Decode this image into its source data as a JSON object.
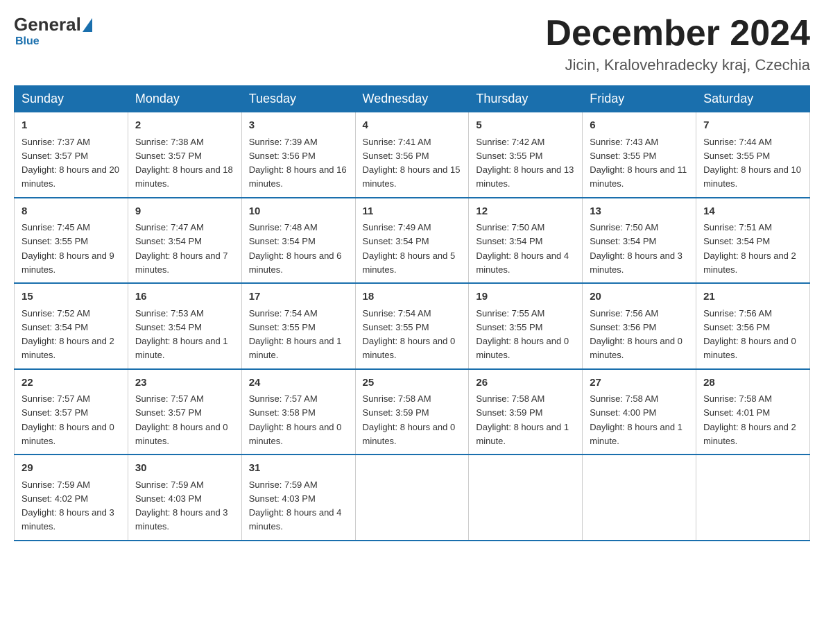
{
  "logo": {
    "general": "General",
    "blue": "Blue"
  },
  "title": "December 2024",
  "location": "Jicin, Kralovehradecky kraj, Czechia",
  "days_of_week": [
    "Sunday",
    "Monday",
    "Tuesday",
    "Wednesday",
    "Thursday",
    "Friday",
    "Saturday"
  ],
  "weeks": [
    [
      {
        "day": "1",
        "sunrise": "7:37 AM",
        "sunset": "3:57 PM",
        "daylight": "8 hours and 20 minutes."
      },
      {
        "day": "2",
        "sunrise": "7:38 AM",
        "sunset": "3:57 PM",
        "daylight": "8 hours and 18 minutes."
      },
      {
        "day": "3",
        "sunrise": "7:39 AM",
        "sunset": "3:56 PM",
        "daylight": "8 hours and 16 minutes."
      },
      {
        "day": "4",
        "sunrise": "7:41 AM",
        "sunset": "3:56 PM",
        "daylight": "8 hours and 15 minutes."
      },
      {
        "day": "5",
        "sunrise": "7:42 AM",
        "sunset": "3:55 PM",
        "daylight": "8 hours and 13 minutes."
      },
      {
        "day": "6",
        "sunrise": "7:43 AM",
        "sunset": "3:55 PM",
        "daylight": "8 hours and 11 minutes."
      },
      {
        "day": "7",
        "sunrise": "7:44 AM",
        "sunset": "3:55 PM",
        "daylight": "8 hours and 10 minutes."
      }
    ],
    [
      {
        "day": "8",
        "sunrise": "7:45 AM",
        "sunset": "3:55 PM",
        "daylight": "8 hours and 9 minutes."
      },
      {
        "day": "9",
        "sunrise": "7:47 AM",
        "sunset": "3:54 PM",
        "daylight": "8 hours and 7 minutes."
      },
      {
        "day": "10",
        "sunrise": "7:48 AM",
        "sunset": "3:54 PM",
        "daylight": "8 hours and 6 minutes."
      },
      {
        "day": "11",
        "sunrise": "7:49 AM",
        "sunset": "3:54 PM",
        "daylight": "8 hours and 5 minutes."
      },
      {
        "day": "12",
        "sunrise": "7:50 AM",
        "sunset": "3:54 PM",
        "daylight": "8 hours and 4 minutes."
      },
      {
        "day": "13",
        "sunrise": "7:50 AM",
        "sunset": "3:54 PM",
        "daylight": "8 hours and 3 minutes."
      },
      {
        "day": "14",
        "sunrise": "7:51 AM",
        "sunset": "3:54 PM",
        "daylight": "8 hours and 2 minutes."
      }
    ],
    [
      {
        "day": "15",
        "sunrise": "7:52 AM",
        "sunset": "3:54 PM",
        "daylight": "8 hours and 2 minutes."
      },
      {
        "day": "16",
        "sunrise": "7:53 AM",
        "sunset": "3:54 PM",
        "daylight": "8 hours and 1 minute."
      },
      {
        "day": "17",
        "sunrise": "7:54 AM",
        "sunset": "3:55 PM",
        "daylight": "8 hours and 1 minute."
      },
      {
        "day": "18",
        "sunrise": "7:54 AM",
        "sunset": "3:55 PM",
        "daylight": "8 hours and 0 minutes."
      },
      {
        "day": "19",
        "sunrise": "7:55 AM",
        "sunset": "3:55 PM",
        "daylight": "8 hours and 0 minutes."
      },
      {
        "day": "20",
        "sunrise": "7:56 AM",
        "sunset": "3:56 PM",
        "daylight": "8 hours and 0 minutes."
      },
      {
        "day": "21",
        "sunrise": "7:56 AM",
        "sunset": "3:56 PM",
        "daylight": "8 hours and 0 minutes."
      }
    ],
    [
      {
        "day": "22",
        "sunrise": "7:57 AM",
        "sunset": "3:57 PM",
        "daylight": "8 hours and 0 minutes."
      },
      {
        "day": "23",
        "sunrise": "7:57 AM",
        "sunset": "3:57 PM",
        "daylight": "8 hours and 0 minutes."
      },
      {
        "day": "24",
        "sunrise": "7:57 AM",
        "sunset": "3:58 PM",
        "daylight": "8 hours and 0 minutes."
      },
      {
        "day": "25",
        "sunrise": "7:58 AM",
        "sunset": "3:59 PM",
        "daylight": "8 hours and 0 minutes."
      },
      {
        "day": "26",
        "sunrise": "7:58 AM",
        "sunset": "3:59 PM",
        "daylight": "8 hours and 1 minute."
      },
      {
        "day": "27",
        "sunrise": "7:58 AM",
        "sunset": "4:00 PM",
        "daylight": "8 hours and 1 minute."
      },
      {
        "day": "28",
        "sunrise": "7:58 AM",
        "sunset": "4:01 PM",
        "daylight": "8 hours and 2 minutes."
      }
    ],
    [
      {
        "day": "29",
        "sunrise": "7:59 AM",
        "sunset": "4:02 PM",
        "daylight": "8 hours and 3 minutes."
      },
      {
        "day": "30",
        "sunrise": "7:59 AM",
        "sunset": "4:03 PM",
        "daylight": "8 hours and 3 minutes."
      },
      {
        "day": "31",
        "sunrise": "7:59 AM",
        "sunset": "4:03 PM",
        "daylight": "8 hours and 4 minutes."
      },
      null,
      null,
      null,
      null
    ]
  ]
}
